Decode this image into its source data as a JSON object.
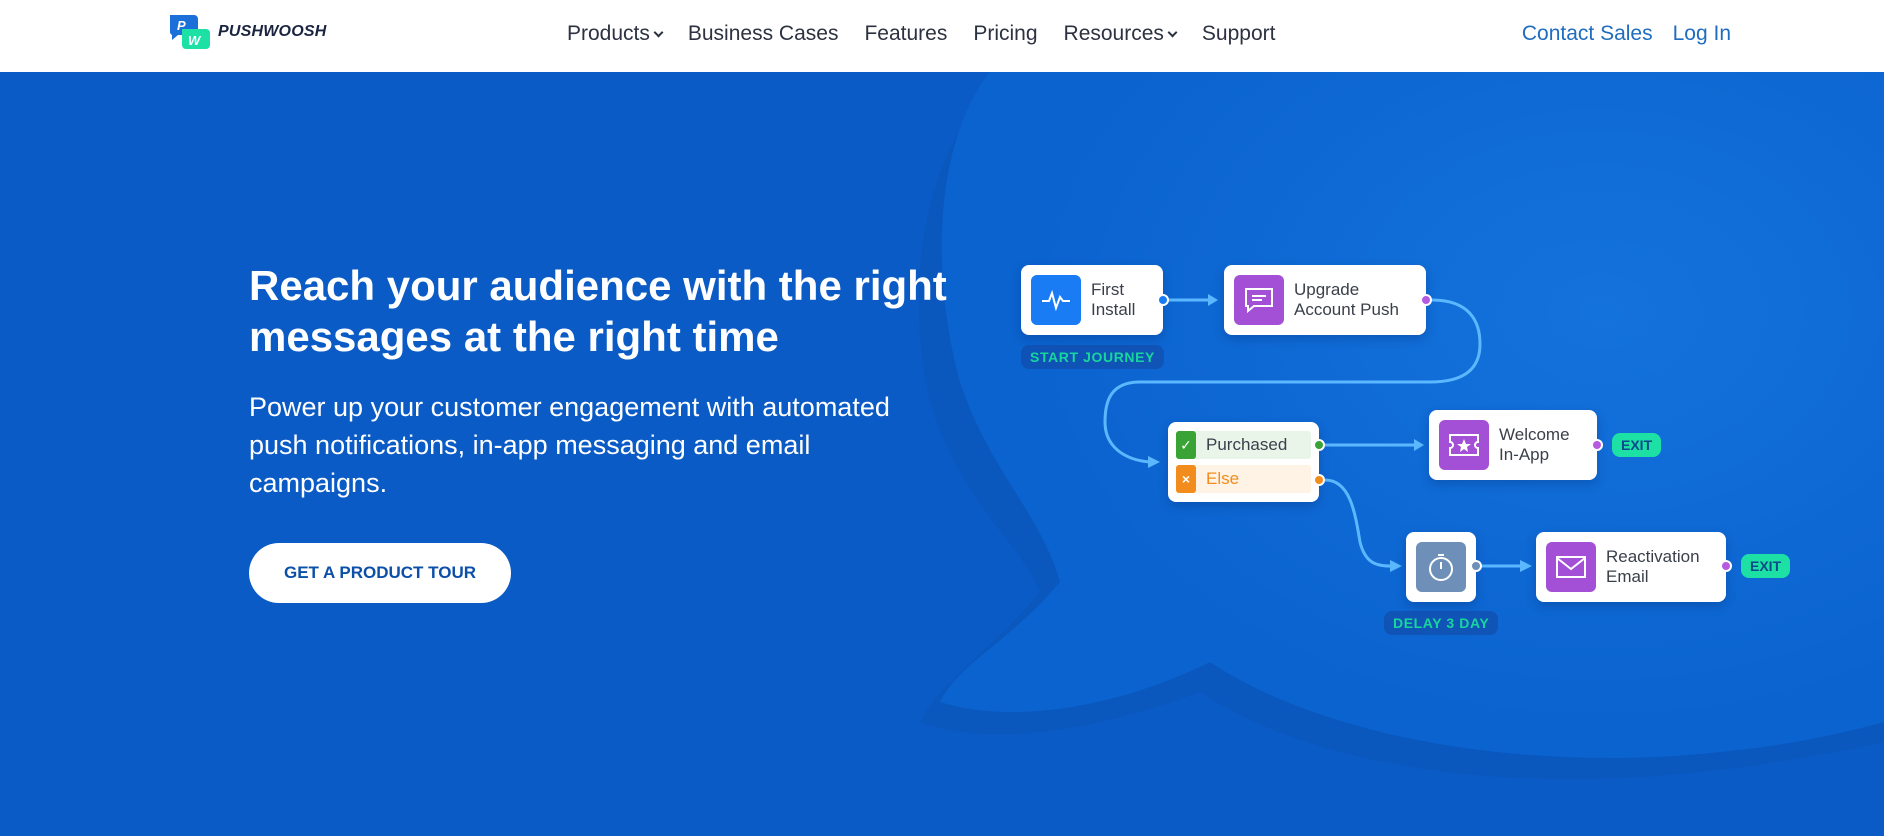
{
  "header": {
    "logo_text": "PUSHWOOSH",
    "nav": [
      {
        "label": "Products",
        "has_dropdown": true
      },
      {
        "label": "Business Cases",
        "has_dropdown": false
      },
      {
        "label": "Features",
        "has_dropdown": false
      },
      {
        "label": "Pricing",
        "has_dropdown": false
      },
      {
        "label": "Resources",
        "has_dropdown": true
      },
      {
        "label": "Support",
        "has_dropdown": false
      }
    ],
    "contact_sales": "Contact Sales",
    "log_in": "Log In"
  },
  "hero": {
    "headline": "Reach your audience with the right messages at the right time",
    "subheadline": "Power up your customer engagement with automated push notifications, in-app messaging and email campaigns.",
    "cta": "GET A PRODUCT TOUR"
  },
  "flow": {
    "first_install": "First Install",
    "start_journey": "START JOURNEY",
    "upgrade_push": "Upgrade Account Push",
    "purchased": "Purchased",
    "else": "Else",
    "welcome_inapp": "Welcome In-App",
    "exit_1": "EXIT",
    "delay": "DELAY 3 DAY",
    "reactivation_email": "Reactivation Email",
    "exit_2": "EXIT"
  },
  "colors": {
    "hero_bg": "#0a5bc6",
    "bubble": "#0d6ad6",
    "accent_green": "#1de0a5",
    "purple": "#a34fd6",
    "blue_icon": "#1a7cf5",
    "link": "#1f6dbf"
  },
  "icons": [
    "pulse-icon",
    "chat-icon",
    "check-icon",
    "cross-icon",
    "ticket-icon",
    "stopwatch-icon",
    "mail-icon"
  ]
}
